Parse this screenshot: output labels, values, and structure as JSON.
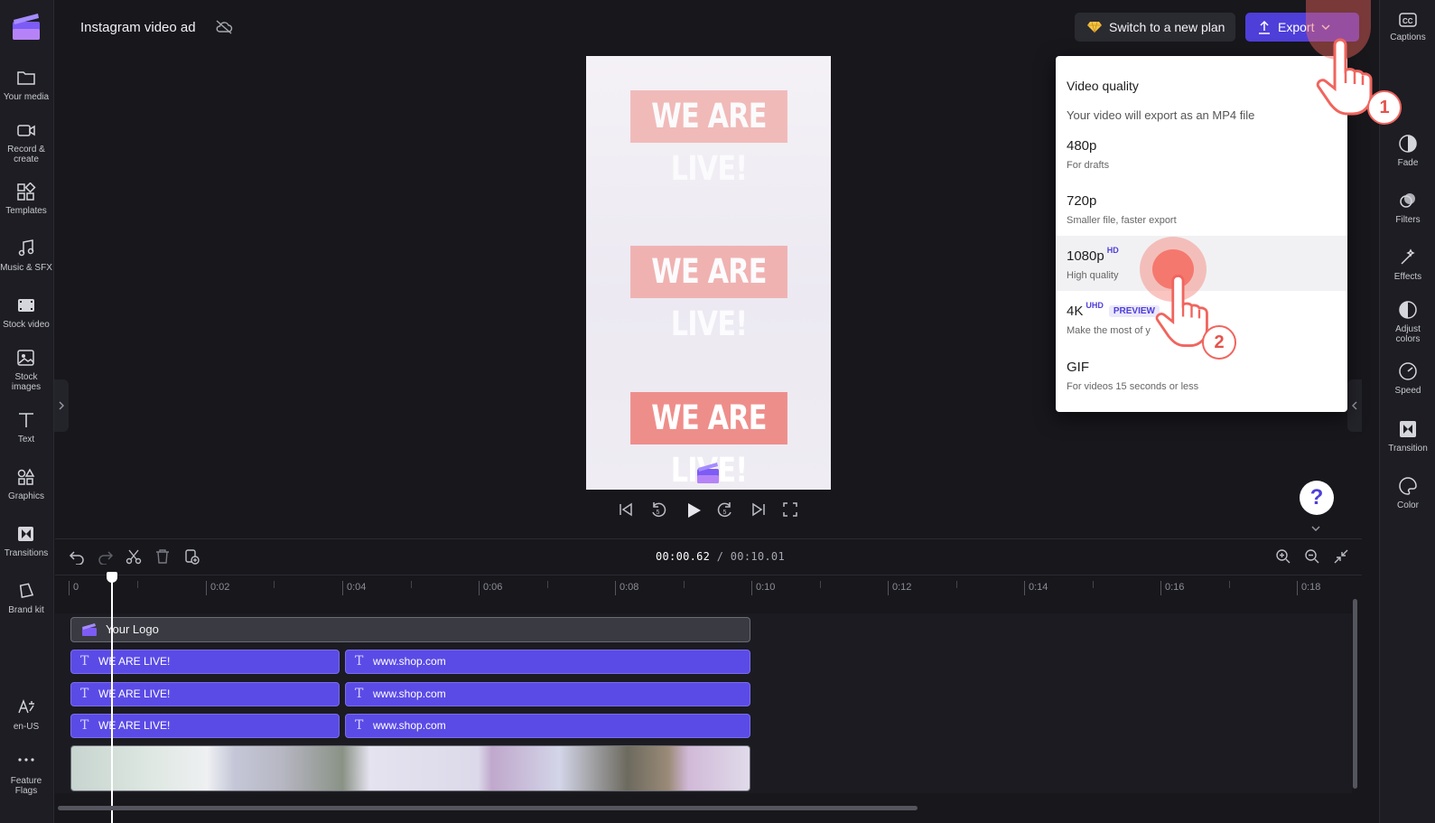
{
  "header": {
    "title": "Instagram video ad",
    "switch_plan_label": "Switch to a new plan",
    "export_label": "Export"
  },
  "left_sidebar": {
    "items": [
      {
        "label": "Your media",
        "icon": "folder-icon"
      },
      {
        "label": "Record &\ncreate",
        "icon": "camera-icon"
      },
      {
        "label": "Templates",
        "icon": "templates-icon"
      },
      {
        "label": "Music & SFX",
        "icon": "music-icon"
      },
      {
        "label": "Stock video",
        "icon": "film-icon"
      },
      {
        "label": "Stock\nimages",
        "icon": "image-icon"
      },
      {
        "label": "Text",
        "icon": "text-icon"
      },
      {
        "label": "Graphics",
        "icon": "shapes-icon"
      },
      {
        "label": "Transitions",
        "icon": "transition-icon"
      },
      {
        "label": "Brand kit",
        "icon": "brand-icon"
      }
    ],
    "bottom": [
      {
        "label": "en-US",
        "icon": "language-icon"
      },
      {
        "label": "Feature\nFlags",
        "icon": "more-icon"
      }
    ]
  },
  "right_sidebar": {
    "items": [
      {
        "label": "Captions",
        "icon": "captions-icon"
      },
      {
        "label": "Fade",
        "icon": "fade-icon"
      },
      {
        "label": "Filters",
        "icon": "filters-icon"
      },
      {
        "label": "Effects",
        "icon": "effects-icon"
      },
      {
        "label": "Adjust\ncolors",
        "icon": "adjust-icon"
      },
      {
        "label": "Speed",
        "icon": "speed-icon"
      },
      {
        "label": "Transition",
        "icon": "transition-icon"
      },
      {
        "label": "Color",
        "icon": "palette-icon"
      }
    ]
  },
  "preview": {
    "overlay_texts": [
      "WE ARE LIVE!",
      "WE ARE LIVE!",
      "WE ARE LIVE!"
    ]
  },
  "timeline": {
    "current_time": "00:00.62",
    "total_time": "/ 00:10.01",
    "ruler": [
      "0",
      "0:02",
      "0:04",
      "0:06",
      "0:08",
      "0:10",
      "0:12",
      "0:14",
      "0:16",
      "0:18"
    ],
    "logo_clip": "Your Logo",
    "text_tracks": [
      {
        "first": "WE ARE LIVE!",
        "second": "www.shop.com"
      },
      {
        "first": "WE ARE LIVE!",
        "second": "www.shop.com"
      },
      {
        "first": "WE ARE LIVE!",
        "second": "www.shop.com"
      }
    ]
  },
  "export_menu": {
    "heading": "Video quality",
    "subheading": "Your video will export as an MP4 file",
    "options": [
      {
        "title": "480p",
        "desc": "For drafts",
        "sup": "",
        "badge": ""
      },
      {
        "title": "720p",
        "desc": "Smaller file, faster export",
        "sup": "",
        "badge": ""
      },
      {
        "title": "1080p",
        "desc": "High quality",
        "sup": "HD",
        "badge": ""
      },
      {
        "title": "4K",
        "desc": "Make the most of y",
        "sup": "UHD",
        "badge": "PREVIEW"
      },
      {
        "title": "GIF",
        "desc": "For videos 15 seconds or less",
        "sup": "",
        "badge": ""
      }
    ]
  },
  "annotations": {
    "step1": "1",
    "step2": "2"
  },
  "help": {
    "label": "?"
  }
}
